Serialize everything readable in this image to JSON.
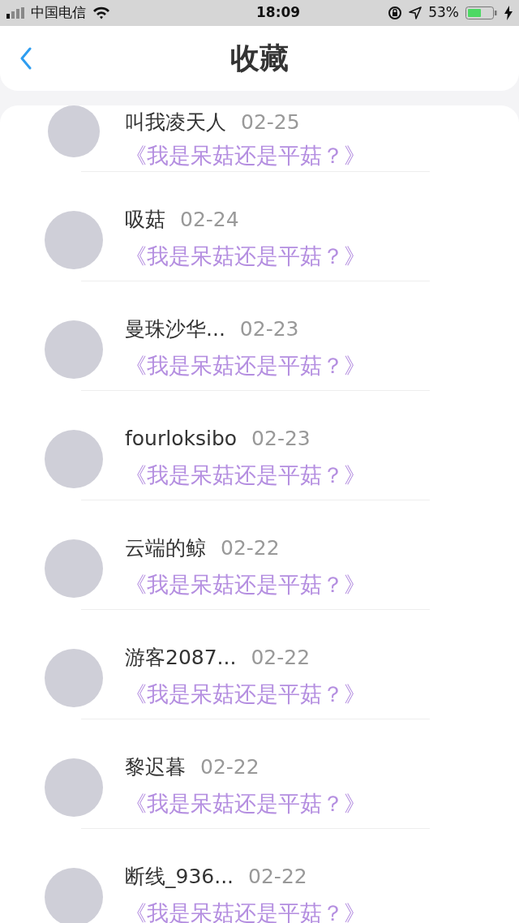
{
  "status_bar": {
    "carrier": "中国电信",
    "time": "18:09",
    "battery": "53%"
  },
  "header": {
    "title": "收藏"
  },
  "favorites": [
    {
      "name": "叫我凌天人",
      "date": "02-25",
      "title": "《我是呆菇还是平菇？》"
    },
    {
      "name": "吸菇",
      "date": "02-24",
      "title": "《我是呆菇还是平菇？》"
    },
    {
      "name": "曼珠沙华...",
      "date": "02-23",
      "title": "《我是呆菇还是平菇？》"
    },
    {
      "name": "fourloksibo",
      "date": "02-23",
      "title": "《我是呆菇还是平菇？》"
    },
    {
      "name": "云端的鲸",
      "date": "02-22",
      "title": "《我是呆菇还是平菇？》"
    },
    {
      "name": "游客2087...",
      "date": "02-22",
      "title": "《我是呆菇还是平菇？》"
    },
    {
      "name": "黎迟暮",
      "date": "02-22",
      "title": "《我是呆菇还是平菇？》"
    },
    {
      "name": "断线_936...",
      "date": "02-22",
      "title": "《我是呆菇还是平菇？》"
    }
  ]
}
